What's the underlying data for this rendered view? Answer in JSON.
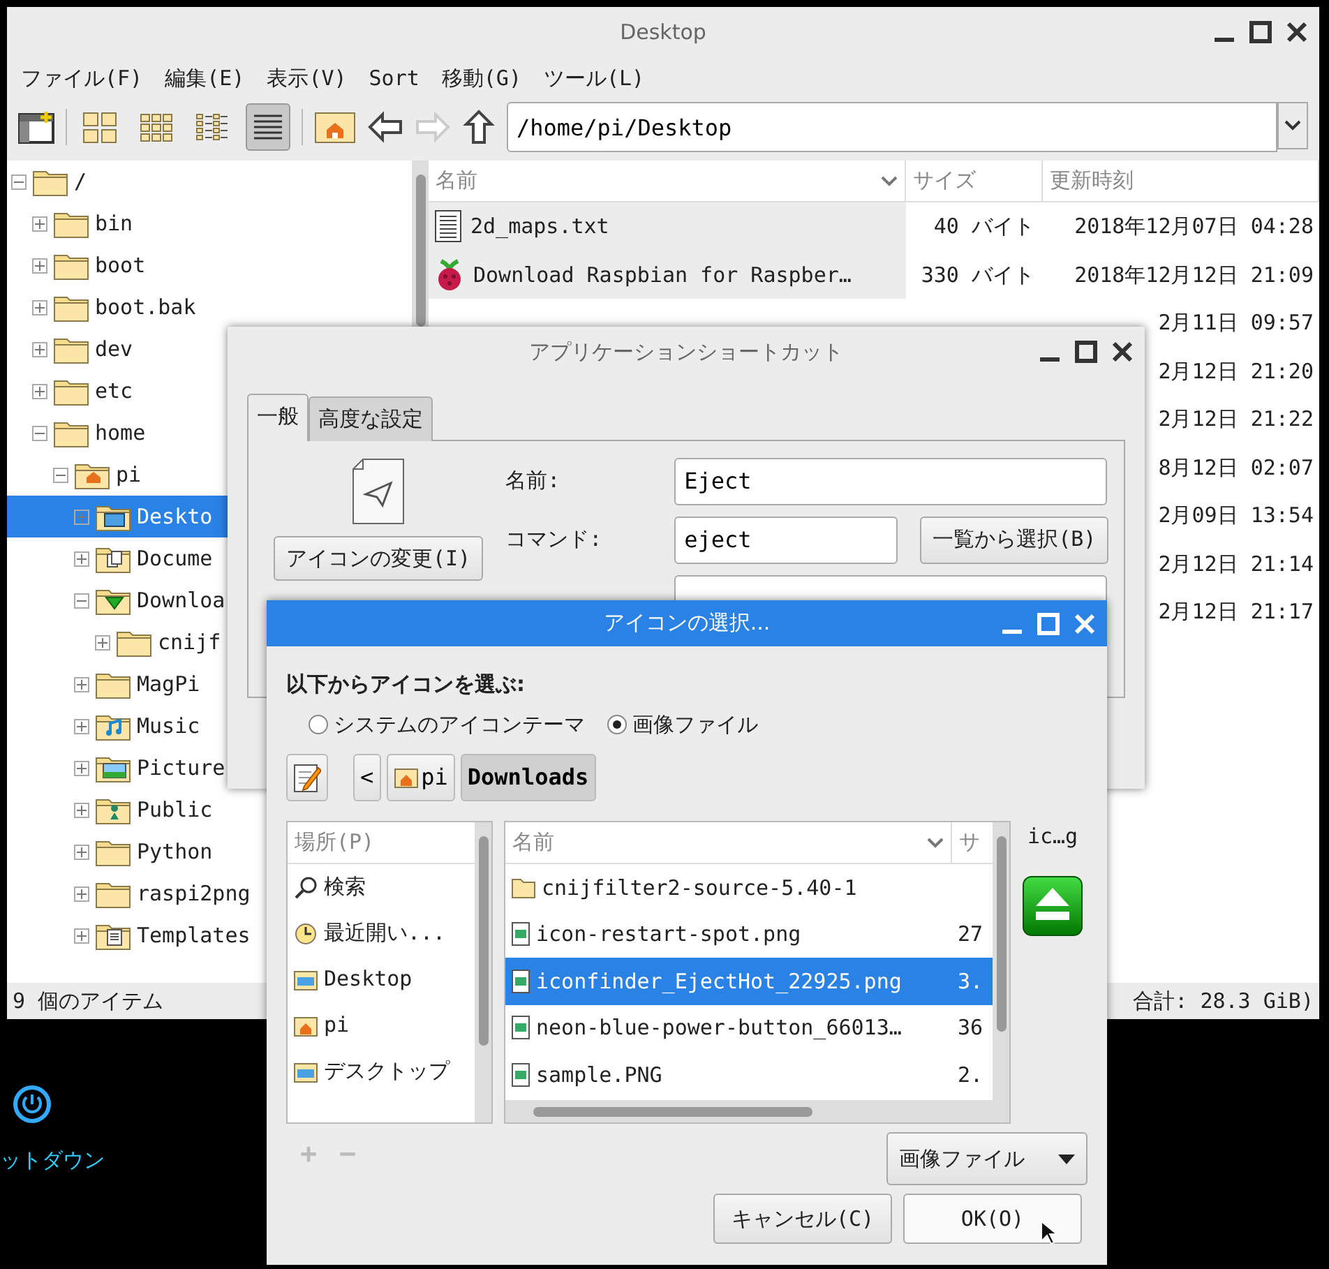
{
  "desktop": {
    "label": "ットダウン"
  },
  "file_manager": {
    "title": "Desktop",
    "menu": [
      "ファイル(F)",
      "編集(E)",
      "表示(V)",
      "Sort",
      "移動(G)",
      "ツール(L)"
    ],
    "views": [
      {
        "kind": "icons",
        "selected": false
      },
      {
        "kind": "thumbnails",
        "selected": false
      },
      {
        "kind": "compact",
        "selected": false
      },
      {
        "kind": "details",
        "selected": true
      }
    ],
    "nav": [
      {
        "kind": "home",
        "disabled": false
      },
      {
        "kind": "back",
        "disabled": false
      },
      {
        "kind": "forward",
        "disabled": true
      },
      {
        "kind": "up",
        "disabled": false
      }
    ],
    "path": "/home/pi/Desktop",
    "tree": [
      {
        "label": "/",
        "kind": "folder",
        "expanded": true,
        "selected": false,
        "children": [
          {
            "label": "bin",
            "kind": "folder",
            "expanded": false,
            "selected": false
          },
          {
            "label": "boot",
            "kind": "folder",
            "expanded": false,
            "selected": false
          },
          {
            "label": "boot.bak",
            "kind": "folder",
            "expanded": false,
            "selected": false
          },
          {
            "label": "dev",
            "kind": "folder",
            "expanded": false,
            "selected": false
          },
          {
            "label": "etc",
            "kind": "folder",
            "expanded": false,
            "selected": false
          },
          {
            "label": "home",
            "kind": "folder",
            "expanded": true,
            "selected": false,
            "children": [
              {
                "label": "pi",
                "kind": "home",
                "expanded": true,
                "selected": false,
                "children": [
                  {
                    "label": "Deskto",
                    "kind": "desktop",
                    "expanded": false,
                    "selected": true
                  },
                  {
                    "label": "Docume",
                    "kind": "documents",
                    "expanded": false,
                    "selected": false
                  },
                  {
                    "label": "Downloa",
                    "kind": "downloads",
                    "expanded": true,
                    "selected": false,
                    "children": [
                      {
                        "label": "cnijf",
                        "kind": "folder",
                        "expanded": false,
                        "selected": false
                      }
                    ]
                  },
                  {
                    "label": "MagPi",
                    "kind": "folder",
                    "expanded": false,
                    "selected": false
                  },
                  {
                    "label": "Music",
                    "kind": "music",
                    "expanded": false,
                    "selected": false
                  },
                  {
                    "label": "Picture",
                    "kind": "pictures",
                    "expanded": false,
                    "selected": false
                  },
                  {
                    "label": "Public",
                    "kind": "public",
                    "expanded": false,
                    "selected": false
                  },
                  {
                    "label": "Python",
                    "kind": "folder",
                    "expanded": false,
                    "selected": false
                  },
                  {
                    "label": "raspi2png",
                    "kind": "folder",
                    "expanded": false,
                    "selected": false
                  },
                  {
                    "label": "Templates",
                    "kind": "templates",
                    "expanded": false,
                    "selected": false
                  }
                ]
              }
            ]
          }
        ]
      }
    ],
    "columns": [
      "名前",
      "サイズ",
      "更新時刻"
    ],
    "rows": [
      {
        "kind": "text",
        "name": "2d_maps.txt",
        "size": "40 バイト",
        "modified": "2018年12月07日 04:28"
      },
      {
        "kind": "raspberry",
        "name": "Download Raspbian for Raspber…",
        "size": "330 バイト",
        "modified": "2018年12月12日 21:09"
      },
      {
        "modified": "2月11日 09:57"
      },
      {
        "modified": "2月12日 21:20"
      },
      {
        "modified": "2月12日 21:22"
      },
      {
        "modified": "8月12日 02:07"
      },
      {
        "modified": "2月09日 13:54"
      },
      {
        "modified": "2月12日 21:14"
      },
      {
        "modified": "2月12日 21:17"
      }
    ],
    "status_left": "9 個のアイテム",
    "status_right": "合計: 28.3 GiB)"
  },
  "app_dialog": {
    "title": "アプリケーションショートカット",
    "tabs": [
      {
        "label": "一般",
        "selected": true
      },
      {
        "label": "高度な設定",
        "selected": false
      }
    ],
    "change_icon_button": "アイコンの変更(I)",
    "fields": [
      {
        "label": "名前:",
        "value": "Eject"
      },
      {
        "label": "コマンド:",
        "value": "eject",
        "button": "一覧から選択(B)"
      }
    ]
  },
  "icon_chooser": {
    "title": "アイコンの選択...",
    "heading": "以下からアイコンを選ぶ:",
    "radios": [
      {
        "label": "システムのアイコンテーマ",
        "selected": false
      },
      {
        "label": "画像ファイル",
        "selected": true
      }
    ],
    "back_button": "<",
    "path": [
      {
        "label": "pi",
        "kind": "home",
        "selected": false
      },
      {
        "label": "Downloads",
        "kind": "plain",
        "selected": true
      }
    ],
    "places_header": "場所(P)",
    "places": [
      {
        "label": "検索",
        "kind": "search"
      },
      {
        "label": "最近開い...",
        "kind": "recent"
      },
      {
        "label": "Desktop",
        "kind": "desktop"
      },
      {
        "label": "pi",
        "kind": "home"
      },
      {
        "label": "デスクトップ",
        "kind": "desktop"
      }
    ],
    "place_buttons": [
      {
        "label": "+",
        "disabled": true
      },
      {
        "label": "−",
        "disabled": true
      }
    ],
    "columns": [
      "名前",
      "サ"
    ],
    "files": [
      {
        "name": "cnijfilter2-source-5.40-1",
        "kind": "folder",
        "selected": false
      },
      {
        "name": "icon-restart-spot.png",
        "kind": "image",
        "size": "27",
        "selected": false
      },
      {
        "name": "iconfinder_EjectHot_22925.png",
        "kind": "image",
        "size": "3.",
        "selected": true
      },
      {
        "name": "neon-blue-power-button_66013…",
        "kind": "image",
        "size": "36",
        "selected": false
      },
      {
        "name": "sample.PNG",
        "kind": "image",
        "size": "2.",
        "selected": false
      }
    ],
    "preview_label": "ic…g",
    "filter": "画像ファイル",
    "buttons": [
      "キャンセル(C)",
      "OK(O)"
    ]
  }
}
